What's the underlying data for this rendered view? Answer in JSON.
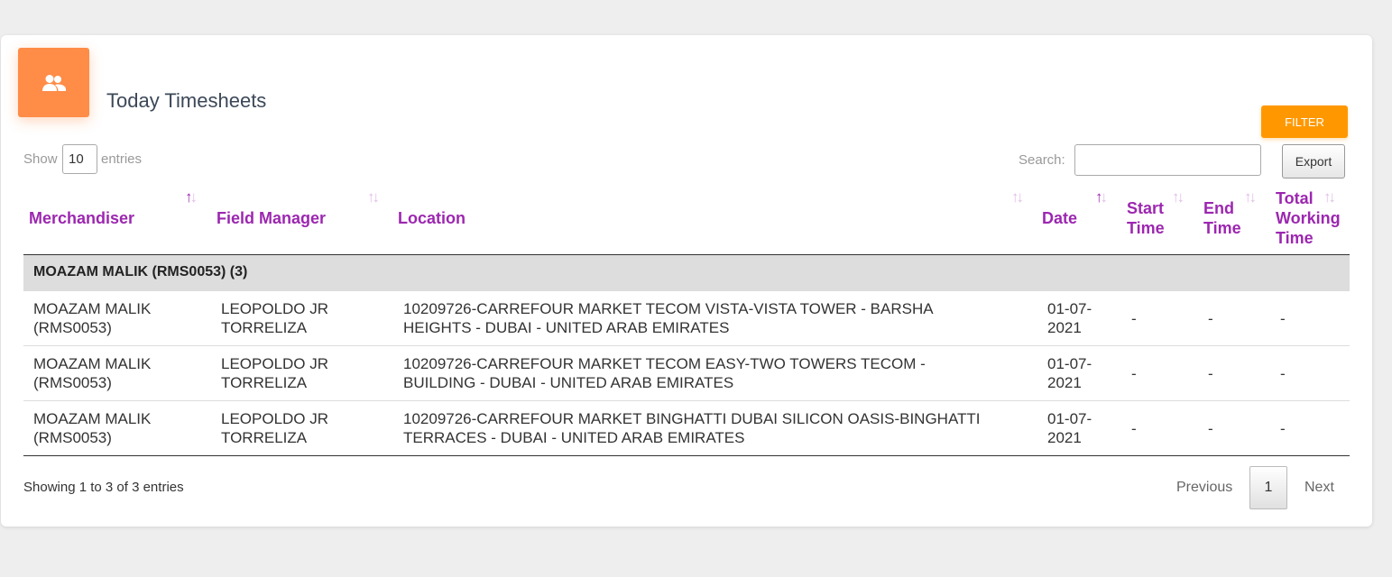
{
  "card": {
    "icon": "people-icon",
    "title": "Today Timesheets",
    "accent_color": "#ff8c47"
  },
  "toolbar": {
    "filter_label": "FILTER",
    "show_label": "Show",
    "entries_value": "10",
    "entries_label": "entries",
    "search_label": "Search:",
    "search_value": "",
    "export_label": "Export"
  },
  "table": {
    "columns": [
      {
        "label": "Merchandiser",
        "sort": "both-up-active"
      },
      {
        "label": "Field Manager",
        "sort": "both"
      },
      {
        "label": "Location",
        "sort": "both"
      },
      {
        "label": "Date",
        "sort": "both-up-active"
      },
      {
        "label_lines": [
          "Start",
          "Time"
        ],
        "sort": "both"
      },
      {
        "label_lines": [
          "End",
          "Time"
        ],
        "sort": "both"
      },
      {
        "label_lines": [
          "Total",
          "Working",
          "Time"
        ],
        "sort": "both"
      }
    ],
    "group_label": "MOAZAM MALIK (RMS0053) (3)",
    "rows": [
      {
        "merchandiser": [
          "MOAZAM MALIK",
          "(RMS0053)"
        ],
        "field_manager": [
          "LEOPOLDO JR",
          "TORRELIZA"
        ],
        "location": [
          "10209726-CARREFOUR MARKET TECOM VISTA-VISTA TOWER - BARSHA",
          "HEIGHTS - DUBAI - UNITED ARAB EMIRATES"
        ],
        "date": [
          "01-07-",
          "2021"
        ],
        "start_time": "-",
        "end_time": "-",
        "total_time": "-"
      },
      {
        "merchandiser": [
          "MOAZAM MALIK",
          "(RMS0053)"
        ],
        "field_manager": [
          "LEOPOLDO JR",
          "TORRELIZA"
        ],
        "location": [
          "10209726-CARREFOUR MARKET TECOM EASY-TWO TOWERS TECOM -",
          "BUILDING - DUBAI - UNITED ARAB EMIRATES"
        ],
        "date": [
          "01-07-",
          "2021"
        ],
        "start_time": "-",
        "end_time": "-",
        "total_time": "-"
      },
      {
        "merchandiser": [
          "MOAZAM MALIK",
          "(RMS0053)"
        ],
        "field_manager": [
          "LEOPOLDO JR",
          "TORRELIZA"
        ],
        "location": [
          "10209726-CARREFOUR MARKET BINGHATTI DUBAI SILICON OASIS-BINGHATTI",
          "TERRACES - DUBAI - UNITED ARAB EMIRATES"
        ],
        "date": [
          "01-07-",
          "2021"
        ],
        "start_time": "-",
        "end_time": "-",
        "total_time": "-"
      }
    ]
  },
  "footer": {
    "info": "Showing 1 to 3 of 3 entries",
    "previous_label": "Previous",
    "current_page": "1",
    "next_label": "Next"
  },
  "colors": {
    "header_text": "#9c27b0",
    "filter_button": "#ff9800",
    "group_row_bg": "#dddddd"
  }
}
